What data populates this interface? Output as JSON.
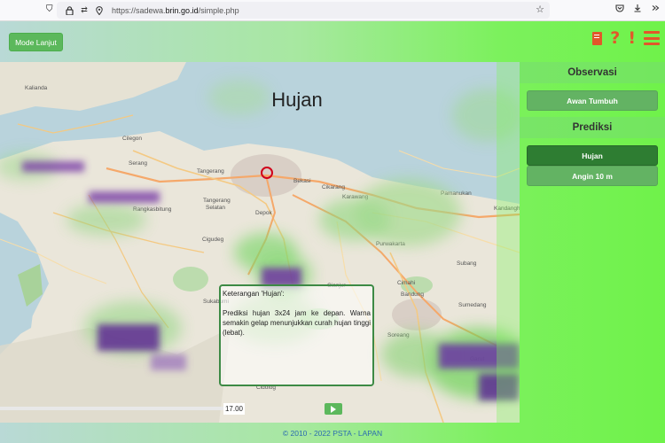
{
  "browser": {
    "url_prefix": "https://sadewa.",
    "url_domain": "brin.go.id",
    "url_path": "/simple.php"
  },
  "toolbar": {
    "mode_button": "Mode Lanjut",
    "icons": [
      "book-icon",
      "help-icon",
      "info-icon",
      "menu-icon"
    ],
    "accent_color": "#e2572a"
  },
  "map": {
    "title": "Hujan",
    "info_box": {
      "heading": "Keterangan 'Hujan':",
      "text": "Prediksi hujan 3x24 jam ke depan. Warna semakin gelap menunjukkan curah hujan tinggi (lebat)."
    },
    "time": "17.00",
    "places": [
      "Kalianda",
      "Jakarta",
      "Depok",
      "Bekasi",
      "Tangerang",
      "Tangerang Selatan",
      "Serang",
      "Cilegon",
      "Cikarang",
      "Karawang",
      "Purwakarta",
      "Subang",
      "Cianjur",
      "Bandung",
      "Cimahi",
      "Sumedang",
      "Soreang",
      "Sukabumi",
      "Pamanukan",
      "Kandanghaur",
      "Cidolog",
      "Garut"
    ]
  },
  "side_panel": {
    "observasi_heading": "Observasi",
    "observasi_items": [
      "Awan Tumbuh"
    ],
    "prediksi_heading": "Prediksi",
    "prediksi_items": [
      "Hujan",
      "Angin 10 m"
    ],
    "active_item": "Hujan"
  },
  "footer": {
    "text": "© 2010 - 2022 PSTA - LAPAN"
  }
}
